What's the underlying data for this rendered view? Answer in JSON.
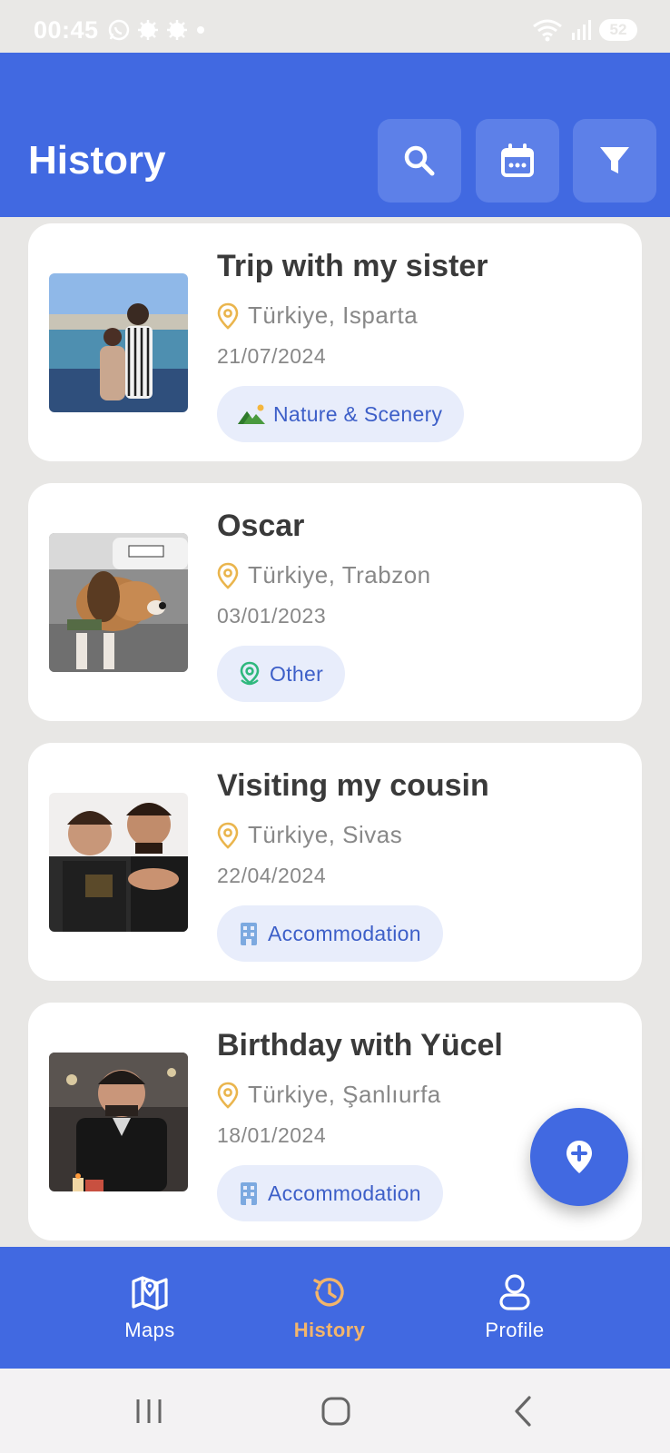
{
  "status_bar": {
    "time": "00:45",
    "battery": "52"
  },
  "header": {
    "title": "History",
    "buttons": [
      "search-icon",
      "calendar-icon",
      "filter-icon"
    ]
  },
  "entries": [
    {
      "title": "Trip with my sister",
      "location": "Türkiye, Isparta",
      "date": "21/07/2024",
      "category": "Nature & Scenery",
      "category_icon": "mountain-icon"
    },
    {
      "title": "Oscar",
      "location": "Türkiye, Trabzon",
      "date": "03/01/2023",
      "category": "Other",
      "category_icon": "map-pin-icon"
    },
    {
      "title": "Visiting my cousin",
      "location": "Türkiye, Sivas",
      "date": "22/04/2024",
      "category": "Accommodation",
      "category_icon": "building-icon"
    },
    {
      "title": "Birthday with Yücel",
      "location": "Türkiye, Şanlıurfa",
      "date": "18/01/2024",
      "category": "Accommodation",
      "category_icon": "building-icon"
    }
  ],
  "bottom_nav": [
    {
      "label": "Maps",
      "icon": "map-icon",
      "active": false
    },
    {
      "label": "History",
      "icon": "history-icon",
      "active": true
    },
    {
      "label": "Profile",
      "icon": "profile-icon",
      "active": false
    }
  ],
  "colors": {
    "primary": "#4169e1",
    "active_nav": "#f3b56b",
    "location_pin": "#eab54d",
    "chip_bg": "#e8edfb"
  }
}
